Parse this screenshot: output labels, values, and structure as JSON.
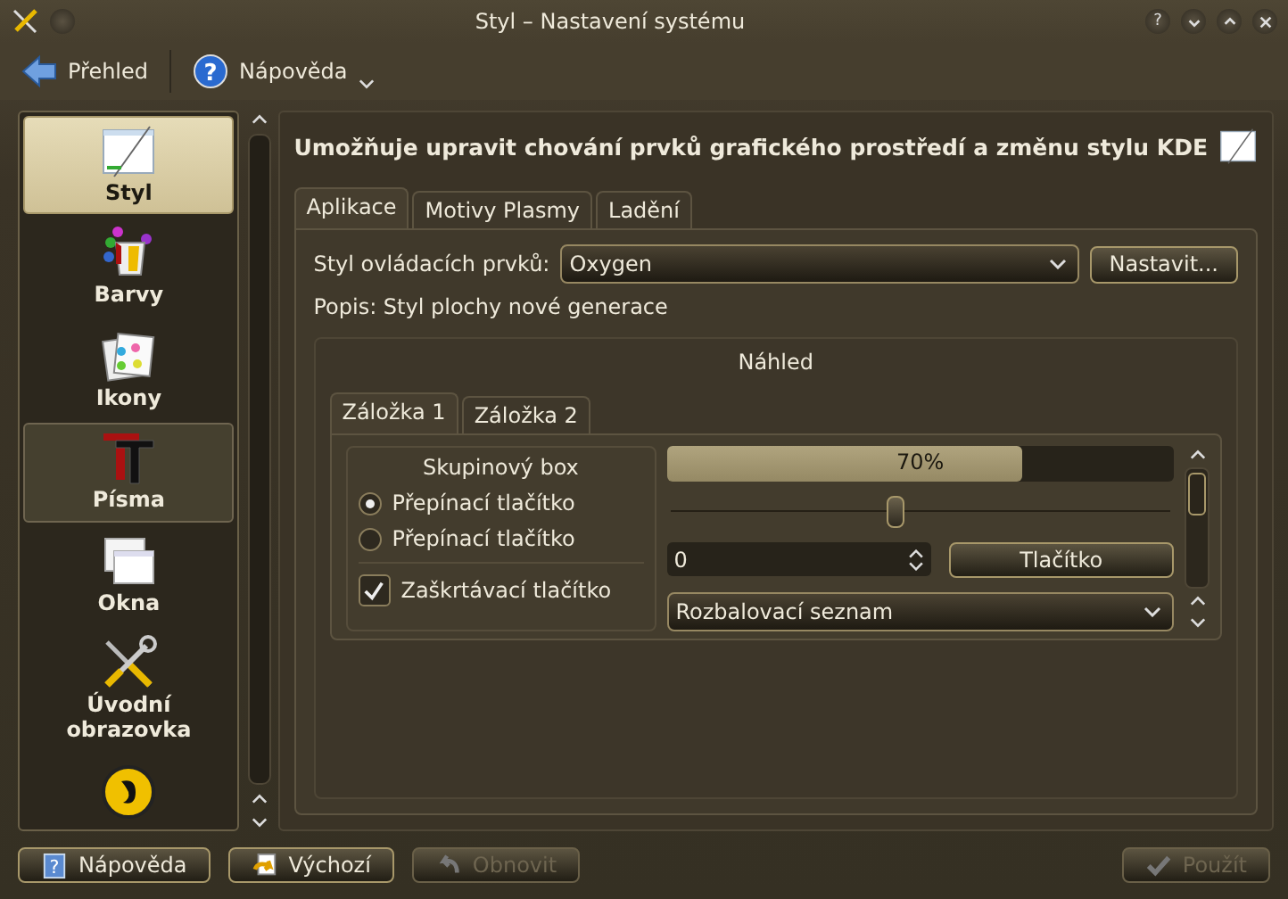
{
  "window": {
    "title": "Styl – Nastavení systému",
    "help_glyph": "?"
  },
  "toolbar": [
    {
      "label": "Přehled",
      "kind": "back",
      "menu": false
    },
    {
      "label": "Nápověda",
      "kind": "help",
      "glyph": "?",
      "menu": true
    }
  ],
  "sidebar": {
    "items": [
      {
        "label": "Styl",
        "selected": true,
        "highlighted": false
      },
      {
        "label": "Barvy",
        "selected": false,
        "highlighted": false
      },
      {
        "label": "Ikony",
        "selected": false,
        "highlighted": false
      },
      {
        "label": "Písma",
        "selected": false,
        "highlighted": true
      },
      {
        "label": "Okna",
        "selected": false,
        "highlighted": false
      },
      {
        "label": "Úvodní obrazovka",
        "selected": false,
        "highlighted": false
      },
      {
        "selected": false,
        "highlighted": false
      }
    ]
  },
  "header": "Umožňuje upravit chování prvků grafického prostředí a změnu stylu KDE",
  "tabs": [
    {
      "label": "Aplikace",
      "selected": true
    },
    {
      "label": "Motivy Plasmy",
      "selected": false
    },
    {
      "label": "Ladění",
      "selected": false
    }
  ],
  "style_field": {
    "label": "Styl ovládacích prvků:",
    "value": "Oxygen",
    "button": "Nastavit..."
  },
  "description": "Popis: Styl plochy nové generace",
  "preview": {
    "title": "Náhled",
    "tabs": [
      {
        "label": "Záložka 1",
        "selected": true
      },
      {
        "label": "Záložka 2",
        "selected": false
      }
    ],
    "group_box": {
      "title": "Skupinový box",
      "radios": [
        {
          "label": "Přepínací tlačítko",
          "selected": true
        },
        {
          "label": "Přepínací tlačítko",
          "selected": false
        }
      ],
      "checkbox": {
        "label": "Zaškrtávací tlačítko",
        "checked": true
      }
    },
    "progress": {
      "level": 0.7,
      "reading": "70%"
    },
    "slider": {
      "level": 0.45
    },
    "spin": {
      "value": "0"
    },
    "button": "Tlačítko",
    "combo": {
      "value": "Rozbalovací seznam"
    }
  },
  "buttons": [
    {
      "label": "Nápověda",
      "kind": "help",
      "glyph": "?",
      "disabled": false
    },
    {
      "label": "Výchozí",
      "kind": "defaults",
      "disabled": false
    },
    {
      "label": "Obnovit",
      "kind": "reset",
      "disabled": true
    },
    {
      "label": "Použít",
      "kind": "apply",
      "disabled": true
    }
  ]
}
